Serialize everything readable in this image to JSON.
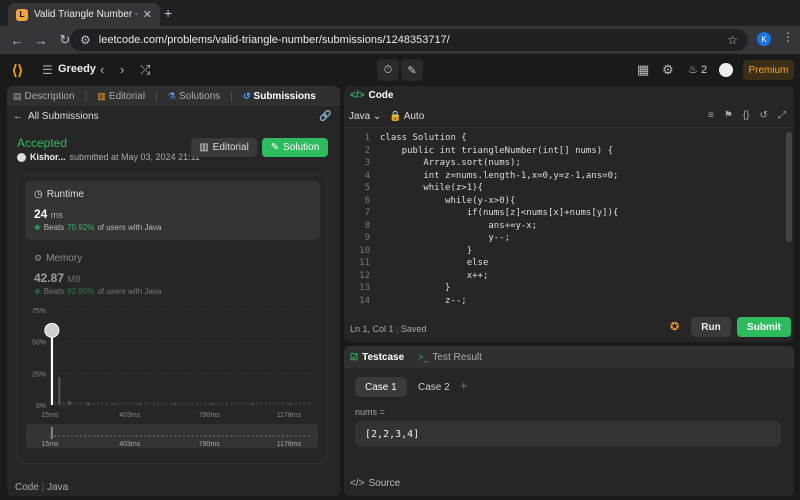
{
  "browser": {
    "tab_title": "Valid Triangle Number - LeetC",
    "url": "leetcode.com/problems/valid-triangle-number/submissions/1248353717/",
    "profile_initial": "K"
  },
  "header": {
    "list_name": "Greedy",
    "streak_count": "2",
    "premium_label": "Premium"
  },
  "left": {
    "tabs": [
      {
        "label": "Description"
      },
      {
        "label": "Editorial"
      },
      {
        "label": "Solutions"
      },
      {
        "label": "Submissions"
      }
    ],
    "all_submissions": "All Submissions",
    "status": "Accepted",
    "author": "Kishor...",
    "submitted_text": "submitted at May 03, 2024 21:11",
    "editorial_btn": "Editorial",
    "solution_btn": "Solution",
    "runtime": {
      "title": "Runtime",
      "value": "24",
      "unit": "ms",
      "beats_prefix": "Beats",
      "beats_pct": "70.92%",
      "beats_suffix": "of users with Java"
    },
    "memory": {
      "title": "Memory",
      "value": "42.87",
      "unit": "MB",
      "beats_prefix": "Beats",
      "beats_pct": "92.95%",
      "beats_suffix": "of users with Java"
    },
    "footer_code": "Code",
    "footer_lang": "Java"
  },
  "chart_data": {
    "type": "bar",
    "y_ticks": [
      "75%",
      "50%",
      "25%",
      "0%"
    ],
    "ylim": [
      0,
      75
    ],
    "x_ticks": [
      "15ms",
      "403ms",
      "790ms",
      "1178ms"
    ],
    "xlim": [
      15,
      1300
    ],
    "highlight_x": 24,
    "values": [
      {
        "x": 24,
        "y": 55
      },
      {
        "x": 60,
        "y": 22
      },
      {
        "x": 110,
        "y": 3
      },
      {
        "x": 200,
        "y": 2
      },
      {
        "x": 320,
        "y": 1
      },
      {
        "x": 450,
        "y": 1
      },
      {
        "x": 620,
        "y": 1
      },
      {
        "x": 800,
        "y": 1
      },
      {
        "x": 1000,
        "y": 1
      },
      {
        "x": 1180,
        "y": 1
      }
    ]
  },
  "code": {
    "title": "Code",
    "language": "Java",
    "indent_mode": "Auto",
    "lines": [
      {
        "n": "1",
        "t": "class Solution {"
      },
      {
        "n": "2",
        "t": "    public int triangleNumber(int[] nums) {"
      },
      {
        "n": "3",
        "t": "        Arrays.sort(nums);"
      },
      {
        "n": "4",
        "t": "        int z=nums.length-1,x=0,y=z-1,ans=0;"
      },
      {
        "n": "5",
        "t": "        while(z>1){"
      },
      {
        "n": "6",
        "t": "            while(y-x>0){"
      },
      {
        "n": "7",
        "t": "                if(nums[z]<nums[x]+nums[y]){"
      },
      {
        "n": "8",
        "t": "                    ans+=y-x;"
      },
      {
        "n": "9",
        "t": "                    y--;"
      },
      {
        "n": "10",
        "t": "                }"
      },
      {
        "n": "11",
        "t": "                else"
      },
      {
        "n": "12",
        "t": "                x++;"
      },
      {
        "n": "13",
        "t": "            }"
      },
      {
        "n": "14",
        "t": "            z--;"
      }
    ],
    "cursor": "Ln 1, Col 1",
    "saved": "Saved",
    "run_label": "Run",
    "submit_label": "Submit"
  },
  "testcase": {
    "tab_testcase": "Testcase",
    "tab_result": "Test Result",
    "case1": "Case 1",
    "case2": "Case 2",
    "input_name": "nums =",
    "input_value": "[2,2,3,4]",
    "source": "Source"
  },
  "colors": {
    "accent_green": "#2cbb5d",
    "brand_orange": "#ffa116"
  }
}
